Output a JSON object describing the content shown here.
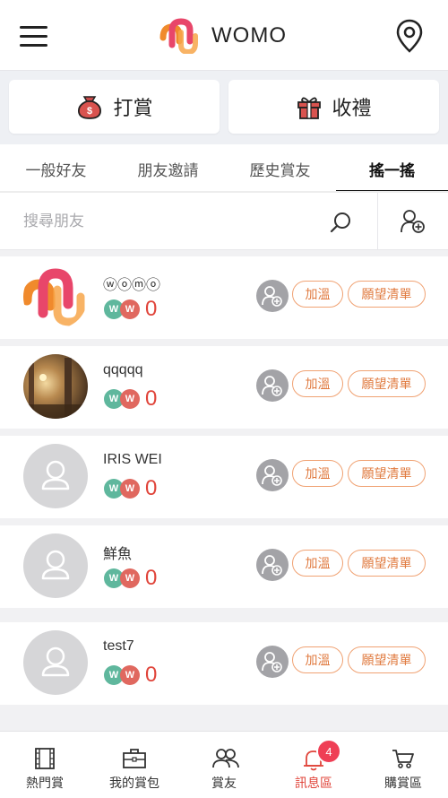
{
  "header": {
    "title": "WOMO",
    "menu_icon": "hamburger-menu-icon",
    "location_icon": "map-pin-icon"
  },
  "actions": {
    "tip_label": "打賞",
    "gift_label": "收禮"
  },
  "tabs": [
    {
      "label": "一般好友",
      "active": false
    },
    {
      "label": "朋友邀請",
      "active": false
    },
    {
      "label": "歷史賞友",
      "active": false
    },
    {
      "label": "搖一搖",
      "active": true
    }
  ],
  "search": {
    "placeholder": "搜尋朋友"
  },
  "friends": [
    {
      "name": "ⓦⓞⓜⓞ",
      "coins": "0",
      "avatar": "womo-logo",
      "warm_label": "加溫",
      "wish_label": "願望清單"
    },
    {
      "name": "qqqqq",
      "coins": "0",
      "avatar": "forest-photo",
      "warm_label": "加溫",
      "wish_label": "願望清單"
    },
    {
      "name": "IRIS WEI",
      "coins": "0",
      "avatar": "placeholder",
      "warm_label": "加溫",
      "wish_label": "願望清單"
    },
    {
      "name": "鮮魚",
      "coins": "0",
      "avatar": "placeholder",
      "warm_label": "加溫",
      "wish_label": "願望清單"
    },
    {
      "name": "test7",
      "coins": "0",
      "avatar": "placeholder",
      "warm_label": "加溫",
      "wish_label": "願望清單"
    }
  ],
  "bottom_nav": [
    {
      "label": "熱門賞",
      "icon": "film-icon",
      "active": false
    },
    {
      "label": "我的賞包",
      "icon": "briefcase-icon",
      "active": false
    },
    {
      "label": "賞友",
      "icon": "people-icon",
      "active": false
    },
    {
      "label": "訊息區",
      "icon": "bell-icon",
      "active": true,
      "badge": "4"
    },
    {
      "label": "購賞區",
      "icon": "cart-icon",
      "active": false
    }
  ],
  "colors": {
    "accent": "#e0443a",
    "pill": "#f0a273",
    "badge": "#ef3f55"
  }
}
